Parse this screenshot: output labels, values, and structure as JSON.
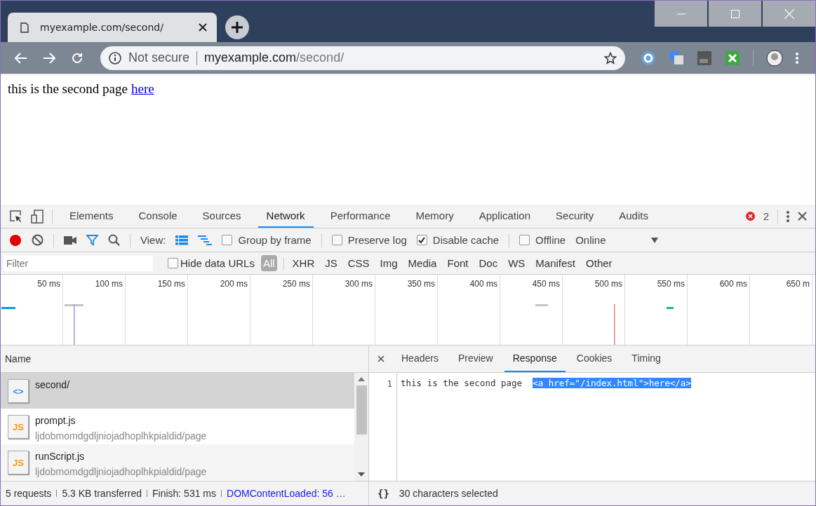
{
  "browser": {
    "tab_title": "myexample.com/second/",
    "security_label": "Not secure",
    "url_host": "myexample.com",
    "url_path": "/second/"
  },
  "page": {
    "text": "this is the second page",
    "link": "here"
  },
  "devtools": {
    "tabs": [
      {
        "label": "Elements",
        "selected": false
      },
      {
        "label": "Console",
        "selected": false
      },
      {
        "label": "Sources",
        "selected": false
      },
      {
        "label": "Network",
        "selected": true
      },
      {
        "label": "Performance",
        "selected": false
      },
      {
        "label": "Memory",
        "selected": false
      },
      {
        "label": "Application",
        "selected": false
      },
      {
        "label": "Security",
        "selected": false
      },
      {
        "label": "Audits",
        "selected": false
      }
    ],
    "error_count": "2",
    "toolbar": {
      "recording": true,
      "view_label": "View:",
      "options": [
        {
          "label": "Group by frame",
          "checked": false
        },
        {
          "label": "Preserve log",
          "checked": false
        },
        {
          "label": "Disable cache",
          "checked": true
        },
        {
          "label": "Offline",
          "checked": false
        }
      ],
      "throttle": "Online"
    },
    "filter": {
      "placeholder": "Filter",
      "hide_data_urls": {
        "label": "Hide data URLs",
        "checked": false
      },
      "types": [
        {
          "label": "All",
          "selected": true
        },
        {
          "label": "XHR",
          "selected": false
        },
        {
          "label": "JS",
          "selected": false
        },
        {
          "label": "CSS",
          "selected": false
        },
        {
          "label": "Img",
          "selected": false
        },
        {
          "label": "Media",
          "selected": false
        },
        {
          "label": "Font",
          "selected": false
        },
        {
          "label": "Doc",
          "selected": false
        },
        {
          "label": "WS",
          "selected": false
        },
        {
          "label": "Manifest",
          "selected": false
        },
        {
          "label": "Other",
          "selected": false
        }
      ]
    },
    "overview_ticks": [
      "50 ms",
      "100 ms",
      "150 ms",
      "200 ms",
      "250 ms",
      "300 ms",
      "350 ms",
      "400 ms",
      "450 ms",
      "500 ms",
      "550 ms",
      "600 ms",
      "650 m"
    ],
    "requests": {
      "header": "Name",
      "rows": [
        {
          "kind": "html",
          "glyph": "<>",
          "name": "second/",
          "path": "",
          "selected": true
        },
        {
          "kind": "script",
          "glyph": "JS",
          "name": "prompt.js",
          "path": "ljdobmomdgdljniojadhoplhkpialdid/page",
          "selected": false
        },
        {
          "kind": "script",
          "glyph": "JS",
          "name": "runScript.js",
          "path": "ljdobmomdgdljniojadhoplhkpialdid/page",
          "selected": false
        }
      ]
    },
    "status": [
      {
        "kind": "text",
        "text": "5 requests"
      },
      {
        "kind": "text",
        "text": "5.3 KB transferred"
      },
      {
        "kind": "text",
        "text": "Finish: 531 ms"
      },
      {
        "kind": "link",
        "text": "DOMContentLoaded: 56 …"
      }
    ],
    "detail": {
      "tabs": [
        {
          "label": "Headers",
          "selected": false
        },
        {
          "label": "Preview",
          "selected": false
        },
        {
          "label": "Response",
          "selected": true
        },
        {
          "label": "Cookies",
          "selected": false
        },
        {
          "label": "Timing",
          "selected": false
        }
      ],
      "lines": [
        {
          "number": "1",
          "text": "this is the second page  ",
          "selected_text": "<a href=\"/index.html\">here</a>"
        }
      ],
      "format_glyph": "{}",
      "status": "30 characters selected"
    }
  }
}
